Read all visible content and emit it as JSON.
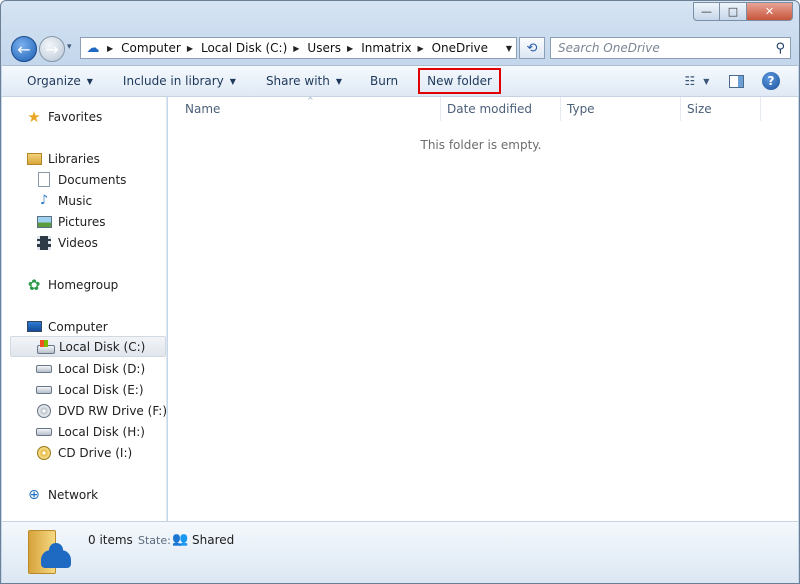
{
  "window": {
    "title_buttons": {
      "minimize": "—",
      "maximize": "□",
      "close": "✕"
    }
  },
  "nav": {
    "back_icon": "←",
    "forward_icon": "→",
    "recent_icon": "▾",
    "refresh_icon": "⟲",
    "breadcrumb": [
      "Computer",
      "Local Disk (C:)",
      "Users",
      "Inmatrix",
      "OneDrive"
    ],
    "search_placeholder": "Search OneDrive",
    "search_icon": "⚲"
  },
  "toolbar": {
    "organize": "Organize",
    "include_in_library": "Include in library",
    "share_with": "Share with",
    "burn": "Burn",
    "new_folder": "New folder",
    "caret": "▼",
    "views_icon": "☷",
    "help": "?"
  },
  "sidebar": {
    "favorites": "Favorites",
    "libraries": "Libraries",
    "library_items": [
      "Documents",
      "Music",
      "Pictures",
      "Videos"
    ],
    "homegroup": "Homegroup",
    "computer": "Computer",
    "drives": [
      "Local Disk (C:)",
      "Local Disk (D:)",
      "Local Disk (E:)",
      "DVD RW Drive (F:)",
      "Local Disk (H:)",
      "CD Drive (I:)"
    ],
    "network": "Network",
    "icons": {
      "star": "★",
      "music": "♪",
      "homegroup": "✿",
      "network": "⊕"
    }
  },
  "content": {
    "columns": [
      "Name",
      "Date modified",
      "Type",
      "Size"
    ],
    "sort_arrow": "^",
    "empty_message": "This folder is empty."
  },
  "details": {
    "item_count": "0 items",
    "state_label": "State:",
    "state_value": "Shared",
    "shared_icon": "👥"
  }
}
